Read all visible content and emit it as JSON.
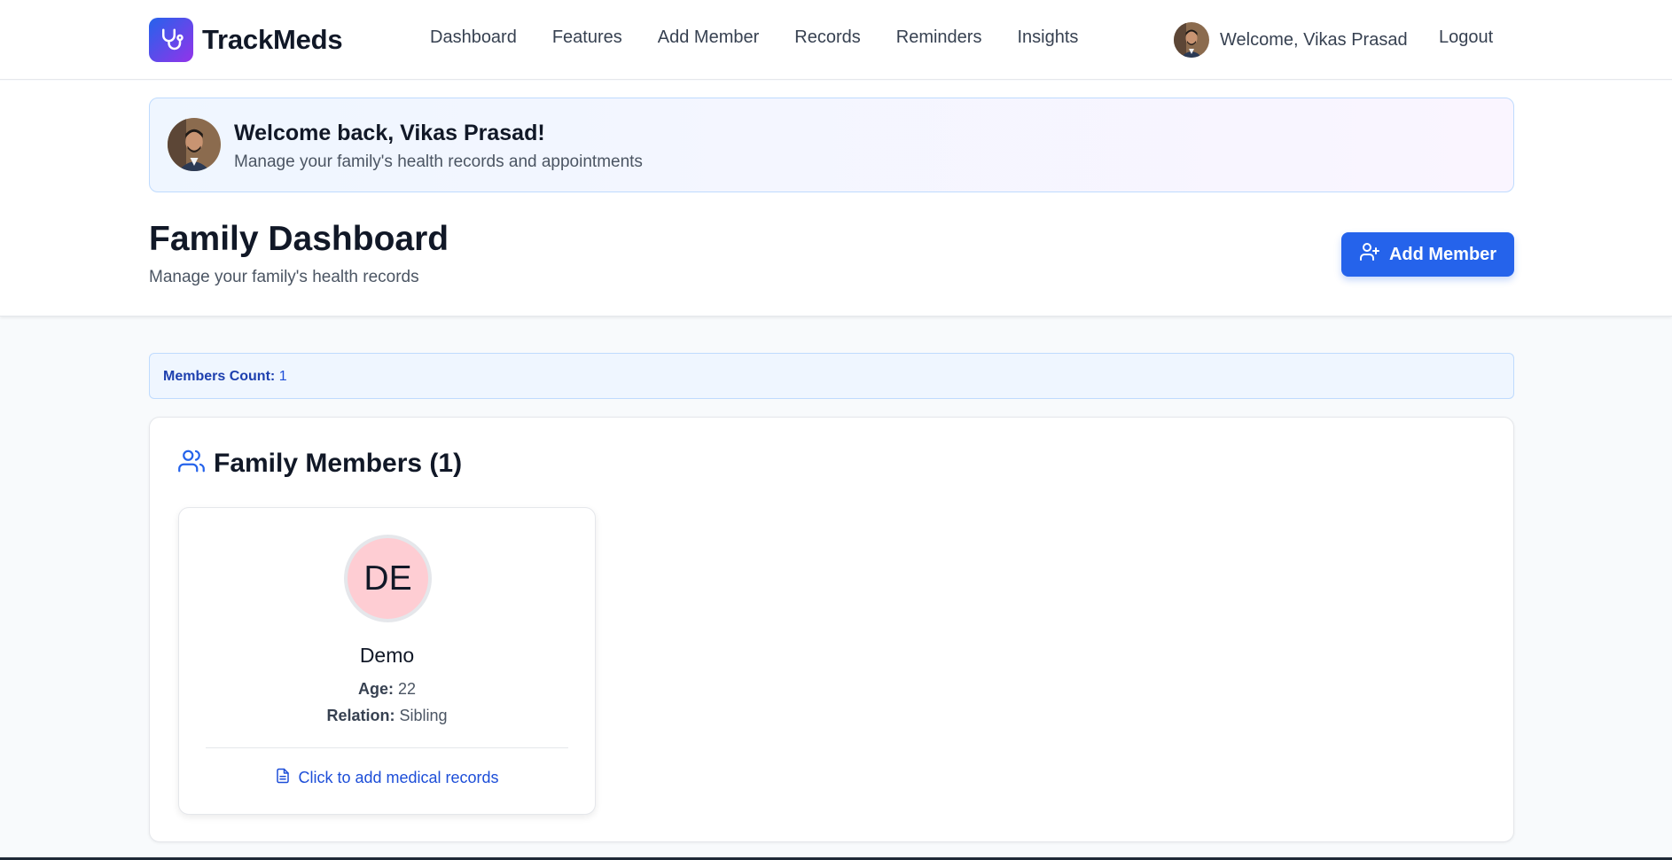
{
  "app": {
    "name": "TrackMeds"
  },
  "nav": {
    "links": [
      "Dashboard",
      "Features",
      "Add Member",
      "Records",
      "Reminders",
      "Insights"
    ],
    "welcome": "Welcome, Vikas Prasad",
    "logout": "Logout"
  },
  "welcome_banner": {
    "title": "Welcome back, Vikas Prasad!",
    "subtitle": "Manage your family's health records and appointments"
  },
  "page": {
    "title": "Family Dashboard",
    "subtitle": "Manage your family's health records",
    "add_button": "Add Member"
  },
  "count": {
    "label": "Members Count:",
    "value": "1"
  },
  "members_section": {
    "title": "Family Members (1)",
    "members": [
      {
        "initials": "DE",
        "name": "Demo",
        "age_label": "Age:",
        "age": "22",
        "relation_label": "Relation:",
        "relation": "Sibling",
        "link": "Click to add medical records"
      }
    ]
  },
  "colors": {
    "accent": "#2563eb",
    "brand_gradient_end": "#9333ea",
    "avatar_bg": "#fecdd3"
  },
  "icons": {
    "logo": "stethoscope-icon",
    "add_button": "user-plus-icon",
    "section": "users-icon",
    "card_link": "file-text-icon"
  }
}
